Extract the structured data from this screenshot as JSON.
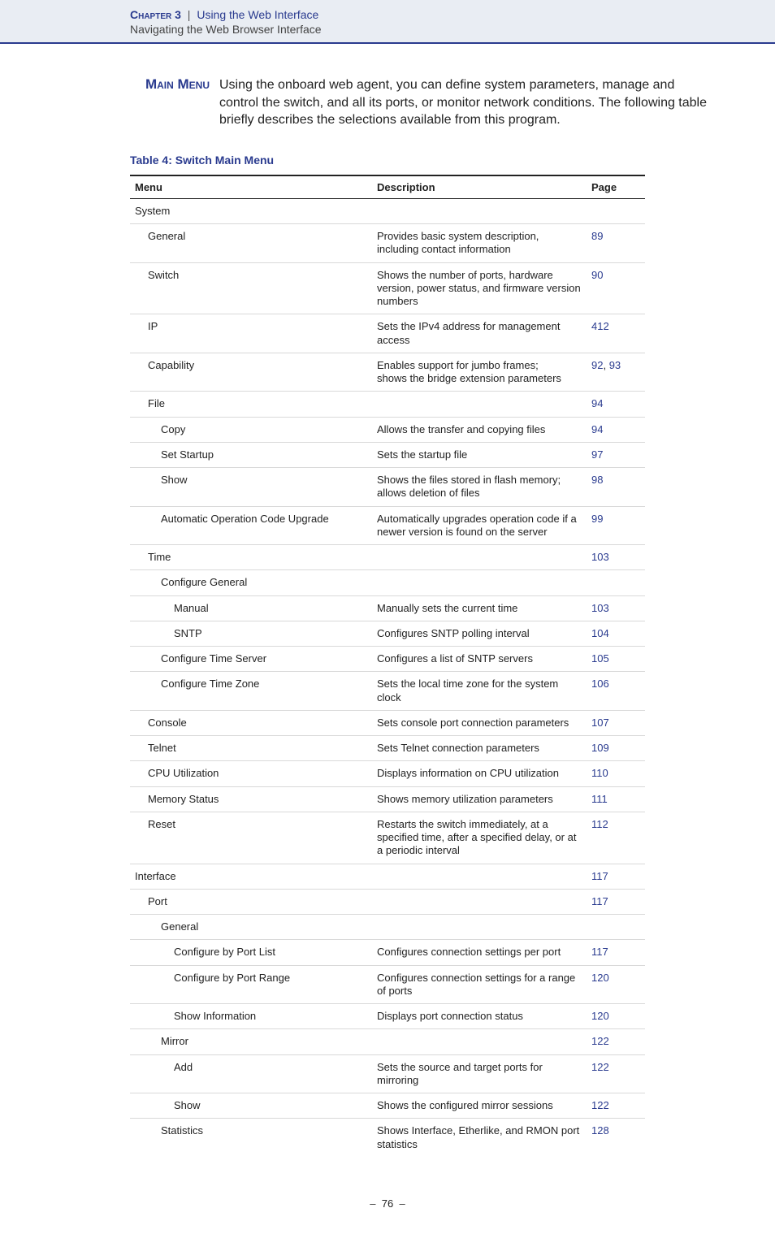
{
  "header": {
    "chapter": "Chapter 3",
    "separator": "|",
    "title": "Using the Web Interface",
    "subtitle": "Navigating the Web Browser Interface"
  },
  "section": {
    "label": "Main Menu",
    "intro": "Using the onboard web agent, you can define system parameters, manage and control the switch, and all its ports, or monitor network conditions. The following table briefly describes the selections available from this program."
  },
  "table": {
    "title": "Table 4: Switch Main Menu",
    "headers": {
      "menu": "Menu",
      "desc": "Description",
      "page": "Page"
    },
    "rows": [
      {
        "menu": "System",
        "indent": 0,
        "desc": "",
        "page": ""
      },
      {
        "menu": "General",
        "indent": 1,
        "desc": "Provides basic system description, including contact information",
        "page": "89"
      },
      {
        "menu": "Switch",
        "indent": 1,
        "desc": "Shows the number of ports, hardware version, power status, and firmware version numbers",
        "page": "90"
      },
      {
        "menu": "IP",
        "indent": 1,
        "desc": "Sets the IPv4 address for management access",
        "page": "412"
      },
      {
        "menu": "Capability",
        "indent": 1,
        "desc": "Enables support for jumbo frames;\nshows the bridge extension parameters",
        "page": "92, 93"
      },
      {
        "menu": "File",
        "indent": 1,
        "desc": "",
        "page": "94"
      },
      {
        "menu": "Copy",
        "indent": 2,
        "desc": "Allows the transfer and copying files",
        "page": "94"
      },
      {
        "menu": "Set Startup",
        "indent": 2,
        "desc": "Sets the startup file",
        "page": "97"
      },
      {
        "menu": "Show",
        "indent": 2,
        "desc": "Shows the files stored in flash memory; allows deletion of files",
        "page": "98"
      },
      {
        "menu": "Automatic Operation Code Upgrade",
        "indent": 2,
        "desc": "Automatically upgrades operation code if a newer version is found on the server",
        "page": "99"
      },
      {
        "menu": "Time",
        "indent": 1,
        "desc": "",
        "page": "103"
      },
      {
        "menu": "Configure General",
        "indent": 2,
        "desc": "",
        "page": ""
      },
      {
        "menu": "Manual",
        "indent": 3,
        "desc": "Manually sets the current time",
        "page": "103"
      },
      {
        "menu": "SNTP",
        "indent": 3,
        "desc": "Configures SNTP polling interval",
        "page": "104"
      },
      {
        "menu": "Configure Time Server",
        "indent": 2,
        "desc": "Configures a list of SNTP servers",
        "page": "105"
      },
      {
        "menu": "Configure Time Zone",
        "indent": 2,
        "desc": "Sets the local time zone for the system clock",
        "page": "106"
      },
      {
        "menu": "Console",
        "indent": 1,
        "desc": "Sets console port connection parameters",
        "page": "107"
      },
      {
        "menu": "Telnet",
        "indent": 1,
        "desc": "Sets Telnet connection parameters",
        "page": "109"
      },
      {
        "menu": "CPU Utilization",
        "indent": 1,
        "desc": "Displays information on CPU utilization",
        "page": "110"
      },
      {
        "menu": "Memory Status",
        "indent": 1,
        "desc": "Shows memory utilization parameters",
        "page": "111"
      },
      {
        "menu": "Reset",
        "indent": 1,
        "desc": "Restarts the switch immediately, at a specified time, after a specified delay, or at a periodic interval",
        "page": "112"
      },
      {
        "menu": "Interface",
        "indent": 0,
        "desc": "",
        "page": "117"
      },
      {
        "menu": "Port",
        "indent": 1,
        "desc": "",
        "page": "117"
      },
      {
        "menu": "General",
        "indent": 2,
        "desc": "",
        "page": ""
      },
      {
        "menu": "Configure by Port List",
        "indent": 3,
        "desc": "Configures connection settings per port",
        "page": "117"
      },
      {
        "menu": "Configure by Port Range",
        "indent": 3,
        "desc": "Configures connection settings for a range of ports",
        "page": "120"
      },
      {
        "menu": "Show Information",
        "indent": 3,
        "desc": "Displays port connection status",
        "page": "120"
      },
      {
        "menu": "Mirror",
        "indent": 2,
        "desc": "",
        "page": "122"
      },
      {
        "menu": "Add",
        "indent": 3,
        "desc": "Sets the source and target ports for mirroring",
        "page": "122"
      },
      {
        "menu": "Show",
        "indent": 3,
        "desc": "Shows the configured mirror sessions",
        "page": "122"
      },
      {
        "menu": "Statistics",
        "indent": 2,
        "desc": "Shows Interface, Etherlike, and RMON port statistics",
        "page": "128"
      }
    ]
  },
  "footer": {
    "dash_left": "–",
    "page_number": "76",
    "dash_right": "–"
  }
}
